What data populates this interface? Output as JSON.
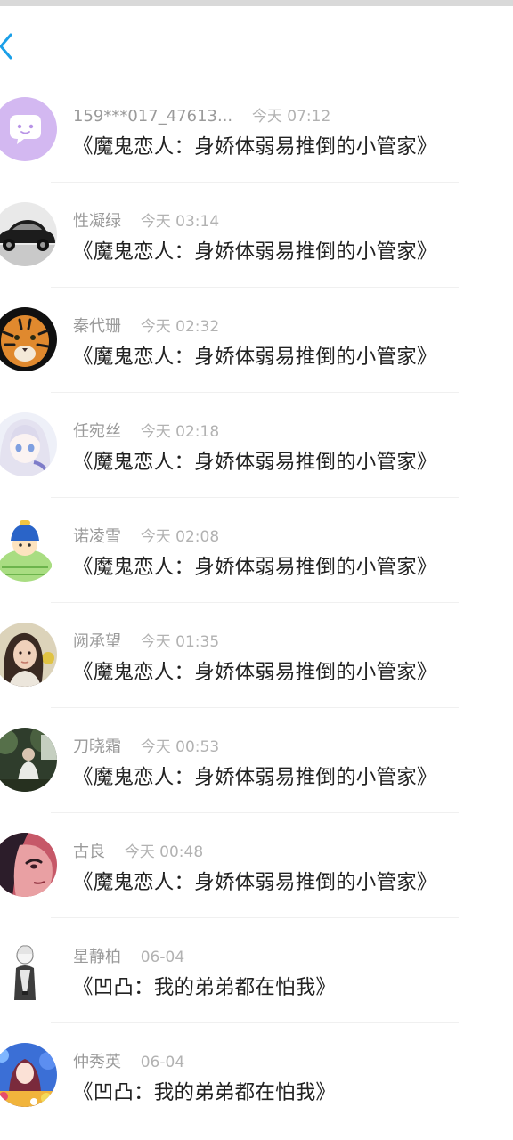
{
  "header": {
    "back_icon": "chevron-left-icon",
    "accent_color": "#1a9fe8"
  },
  "items": [
    {
      "name": "159***017_47613...",
      "time": "今天 07:12",
      "title": "《魔鬼恋人：身娇体弱易推倒的小管家》",
      "avatar": "chat-bubble-avatar"
    },
    {
      "name": "性凝绿",
      "time": "今天 03:14",
      "title": "《魔鬼恋人：身娇体弱易推倒的小管家》",
      "avatar": "car-photo-avatar"
    },
    {
      "name": "秦代珊",
      "time": "今天 02:32",
      "title": "《魔鬼恋人：身娇体弱易推倒的小管家》",
      "avatar": "tiger-photo-avatar"
    },
    {
      "name": "任宛丝",
      "time": "今天 02:18",
      "title": "《魔鬼恋人：身娇体弱易推倒的小管家》",
      "avatar": "anime-girl-avatar"
    },
    {
      "name": "诺凌雪",
      "time": "今天 02:08",
      "title": "《魔鬼恋人：身娇体弱易推倒的小管家》",
      "avatar": "cartoon-character-avatar"
    },
    {
      "name": "阙承望",
      "time": "今天 01:35",
      "title": "《魔鬼恋人：身娇体弱易推倒的小管家》",
      "avatar": "woman-photo-avatar"
    },
    {
      "name": "刀晓霜",
      "time": "今天 00:53",
      "title": "《魔鬼恋人：身娇体弱易推倒的小管家》",
      "avatar": "forest-person-avatar"
    },
    {
      "name": "古良",
      "time": "今天 00:48",
      "title": "《魔鬼恋人：身娇体弱易推倒的小管家》",
      "avatar": "anime-face-avatar"
    },
    {
      "name": "星静柏",
      "time": "06-04",
      "title": "《凹凸：我的弟弟都在怕我》",
      "avatar": "sketch-boy-avatar"
    },
    {
      "name": "仲秀英",
      "time": "06-04",
      "title": "《凹凸：我的弟弟都在怕我》",
      "avatar": "anime-colorful-avatar"
    }
  ]
}
